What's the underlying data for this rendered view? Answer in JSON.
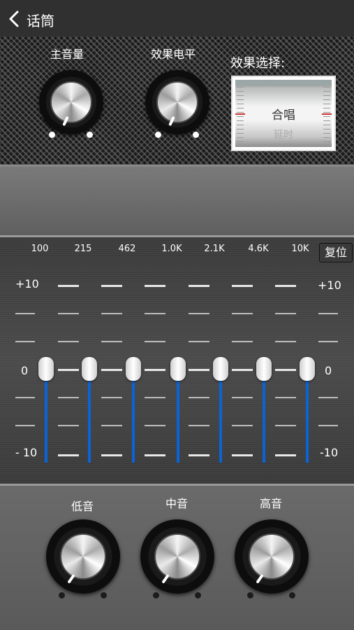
{
  "nav": {
    "title": "话筒",
    "back_icon": "chevron-left-icon"
  },
  "top": {
    "master_volume_label": "主音量",
    "effect_level_label": "效果电平",
    "effect_select_label": "效果选择:",
    "effect_current": "合唱",
    "effect_next": "延时"
  },
  "eq": {
    "frequencies": [
      "100",
      "215",
      "462",
      "1.0K",
      "2.1K",
      "4.6K",
      "10K"
    ],
    "reset_label": "复位",
    "scale": {
      "max_left": "+10",
      "max_right": "+10",
      "zero_left": "0",
      "zero_right": "0",
      "min_left": "- 10",
      "min_right": "-10"
    },
    "band_values_db": [
      0,
      0,
      0,
      0,
      0,
      0,
      0
    ]
  },
  "tone": {
    "low_label": "低音",
    "mid_label": "中音",
    "high_label": "高音"
  },
  "colors": {
    "eq_track": "#0a63d8",
    "background": "#2a2a2a"
  }
}
